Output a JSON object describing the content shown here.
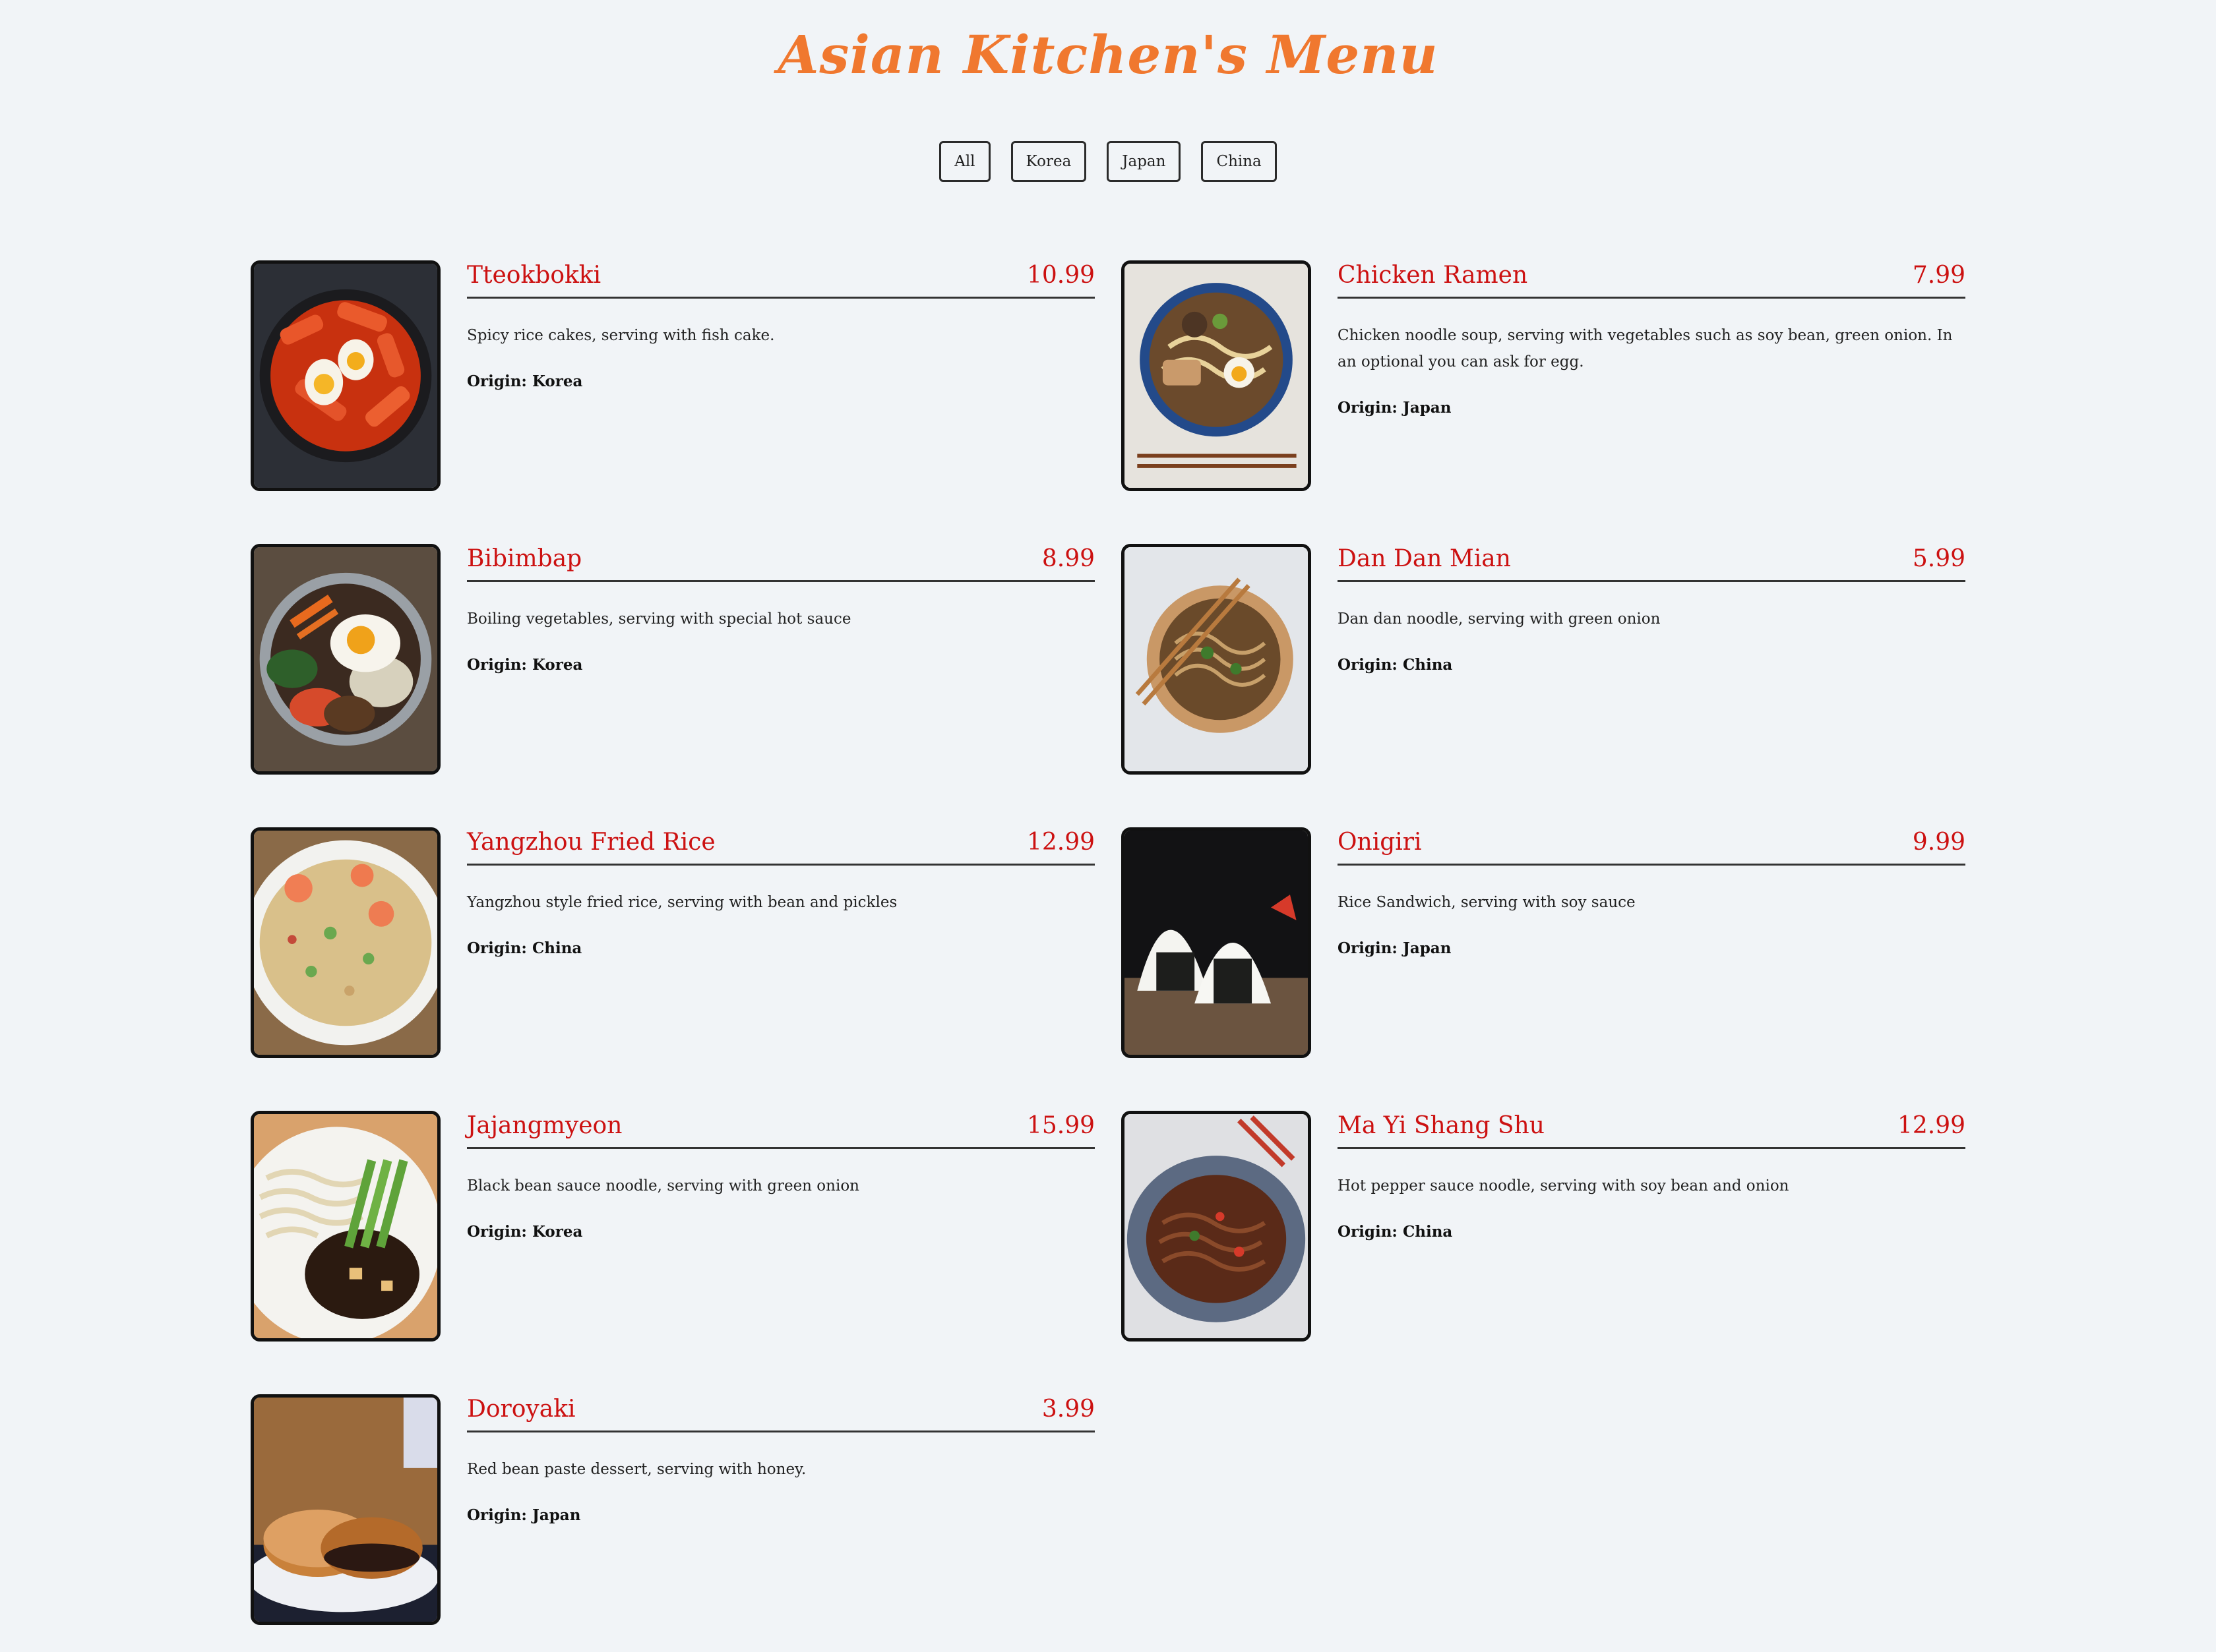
{
  "page": {
    "title": "Asian Kitchen's Menu"
  },
  "filters": [
    "All",
    "Korea",
    "Japan",
    "China"
  ],
  "origin_label": "Origin:",
  "items": [
    {
      "name": "Tteokbokki",
      "price": "10.99",
      "desc": "Spicy rice cakes, serving with fish cake.",
      "origin": "Korea",
      "image": "tteokbokki-photo"
    },
    {
      "name": "Chicken Ramen",
      "price": "7.99",
      "desc": "Chicken noodle soup, serving with vegetables such as soy bean, green onion. In an optional you can ask for egg.",
      "origin": "Japan",
      "image": "ramen-photo"
    },
    {
      "name": "Bibimbap",
      "price": "8.99",
      "desc": "Boiling vegetables, serving with special hot sauce",
      "origin": "Korea",
      "image": "bibimbap-photo"
    },
    {
      "name": "Dan Dan Mian",
      "price": "5.99",
      "desc": "Dan dan noodle, serving with green onion",
      "origin": "China",
      "image": "dandan-photo"
    },
    {
      "name": "Yangzhou Fried Rice",
      "price": "12.99",
      "desc": "Yangzhou style fried rice, serving with bean and pickles",
      "origin": "China",
      "image": "fried-rice-photo"
    },
    {
      "name": "Onigiri",
      "price": "9.99",
      "desc": "Rice Sandwich, serving with soy sauce",
      "origin": "Japan",
      "image": "onigiri-photo"
    },
    {
      "name": "Jajangmyeon",
      "price": "15.99",
      "desc": "Black bean sauce noodle, serving with green onion",
      "origin": "Korea",
      "image": "jajangmyeon-photo"
    },
    {
      "name": "Ma Yi Shang Shu",
      "price": "12.99",
      "desc": "Hot pepper sauce noodle, serving with soy bean and onion",
      "origin": "China",
      "image": "mayi-photo"
    },
    {
      "name": "Doroyaki",
      "price": "3.99",
      "desc": "Red bean paste dessert, serving with honey.",
      "origin": "Japan",
      "image": "dorayaki-photo"
    }
  ]
}
